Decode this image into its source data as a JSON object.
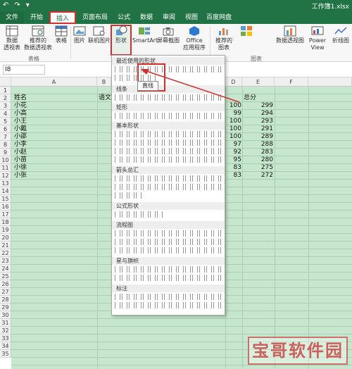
{
  "titlebar": {
    "quick_access": [
      "↶",
      "↷",
      "▾"
    ],
    "doc_title": "工作簿1.xlsx"
  },
  "tabs": [
    {
      "label": "文件"
    },
    {
      "label": "开始"
    },
    {
      "label": "插入"
    },
    {
      "label": "页面布局"
    },
    {
      "label": "公式"
    },
    {
      "label": "数据"
    },
    {
      "label": "审阅"
    },
    {
      "label": "视图"
    },
    {
      "label": "百度网盘"
    }
  ],
  "ribbon": {
    "buttons": [
      {
        "label": "数据\n透视表"
      },
      {
        "label": "推荐的\n数据透视表"
      },
      {
        "label": "表格"
      },
      {
        "label": "图片"
      },
      {
        "label": "联机图片"
      },
      {
        "label": "形状"
      },
      {
        "label": "SmartArt"
      },
      {
        "label": "屏幕截图"
      },
      {
        "label": "Office\n应用程序"
      },
      {
        "label": "推荐的\n图表"
      },
      {
        "label": "数据透视图"
      },
      {
        "label": "Power\nView"
      },
      {
        "label": "折线图"
      }
    ],
    "groups": [
      "表格",
      "图表"
    ]
  },
  "formula": {
    "namebox": "I8"
  },
  "columns": [
    "A",
    "B",
    "C",
    "D",
    "E",
    "F"
  ],
  "rows": [
    "1",
    "2",
    "3",
    "4",
    "5",
    "6",
    "7",
    "8",
    "9",
    "10",
    "11",
    "12",
    "13",
    "14",
    "15",
    "16",
    "17",
    "18",
    "19",
    "20",
    "21",
    "22",
    "23",
    "24",
    "25",
    "26",
    "27",
    "28",
    "29",
    "30",
    "31",
    "32",
    "33",
    "34",
    "35"
  ],
  "sheet": {
    "header": {
      "name": "姓名",
      "chinese": "语文",
      "total": "总分"
    },
    "students": [
      {
        "name": "小花",
        "score": "100",
        "total": "299"
      },
      {
        "name": "小高",
        "score": "99",
        "total": "294"
      },
      {
        "name": "小王",
        "score": "100",
        "total": "293"
      },
      {
        "name": "小戴",
        "score": "100",
        "total": "291"
      },
      {
        "name": "小邵",
        "score": "100",
        "total": "289"
      },
      {
        "name": "小李",
        "score": "97",
        "total": "288"
      },
      {
        "name": "小赵",
        "score": "92",
        "total": "283"
      },
      {
        "name": "小苗",
        "score": "95",
        "total": "280"
      },
      {
        "name": "小徐",
        "score": "83",
        "total": "275"
      },
      {
        "name": "小张",
        "score": "83",
        "total": "272"
      }
    ]
  },
  "shapes_menu": {
    "sections": [
      "最近使用的形状",
      "线条",
      "矩形",
      "基本形状",
      "箭头总汇",
      "公式形状",
      "流程图",
      "星与旗帜",
      "标注"
    ],
    "tooltip": "直线"
  },
  "watermark": "宝哥软件园",
  "colors": {
    "excel_green": "#217346",
    "highlight_red": "#d32f2f",
    "cell_fill": "#c6e7cd"
  }
}
